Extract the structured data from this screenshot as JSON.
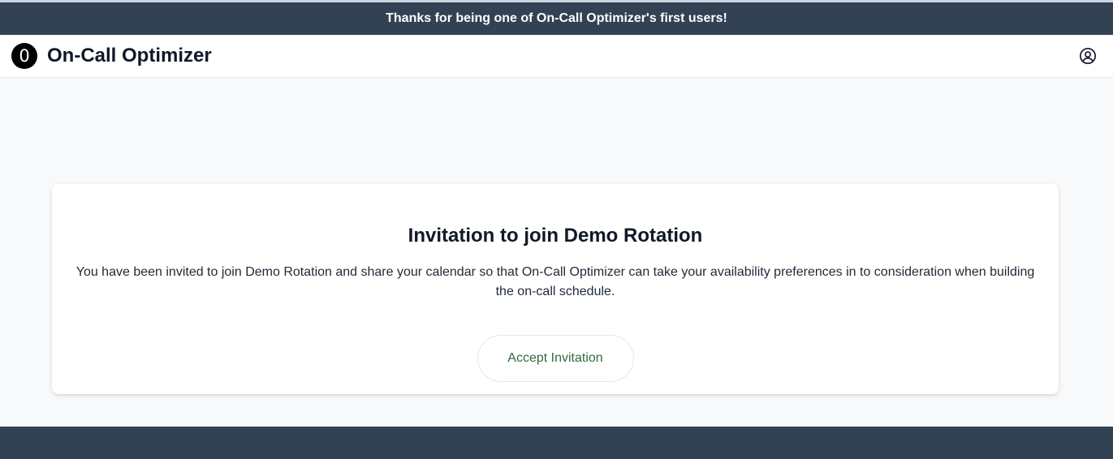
{
  "announcement": {
    "text": "Thanks for being one of On-Call Optimizer's first users!"
  },
  "navbar": {
    "logo_glyph": "0",
    "app_name": "On-Call Optimizer",
    "profile_icon": "user-circle-icon"
  },
  "invitation": {
    "title": "Invitation to join Demo Rotation",
    "message": "You have been invited to join Demo Rotation and share your calendar so that On-Call Optimizer can take your availability preferences in to consideration when building the on-call schedule.",
    "accept_label": "Accept Invitation"
  },
  "colors": {
    "banner": "#334155",
    "accent_text": "#2f6b3f",
    "background": "#f7f9fa"
  }
}
